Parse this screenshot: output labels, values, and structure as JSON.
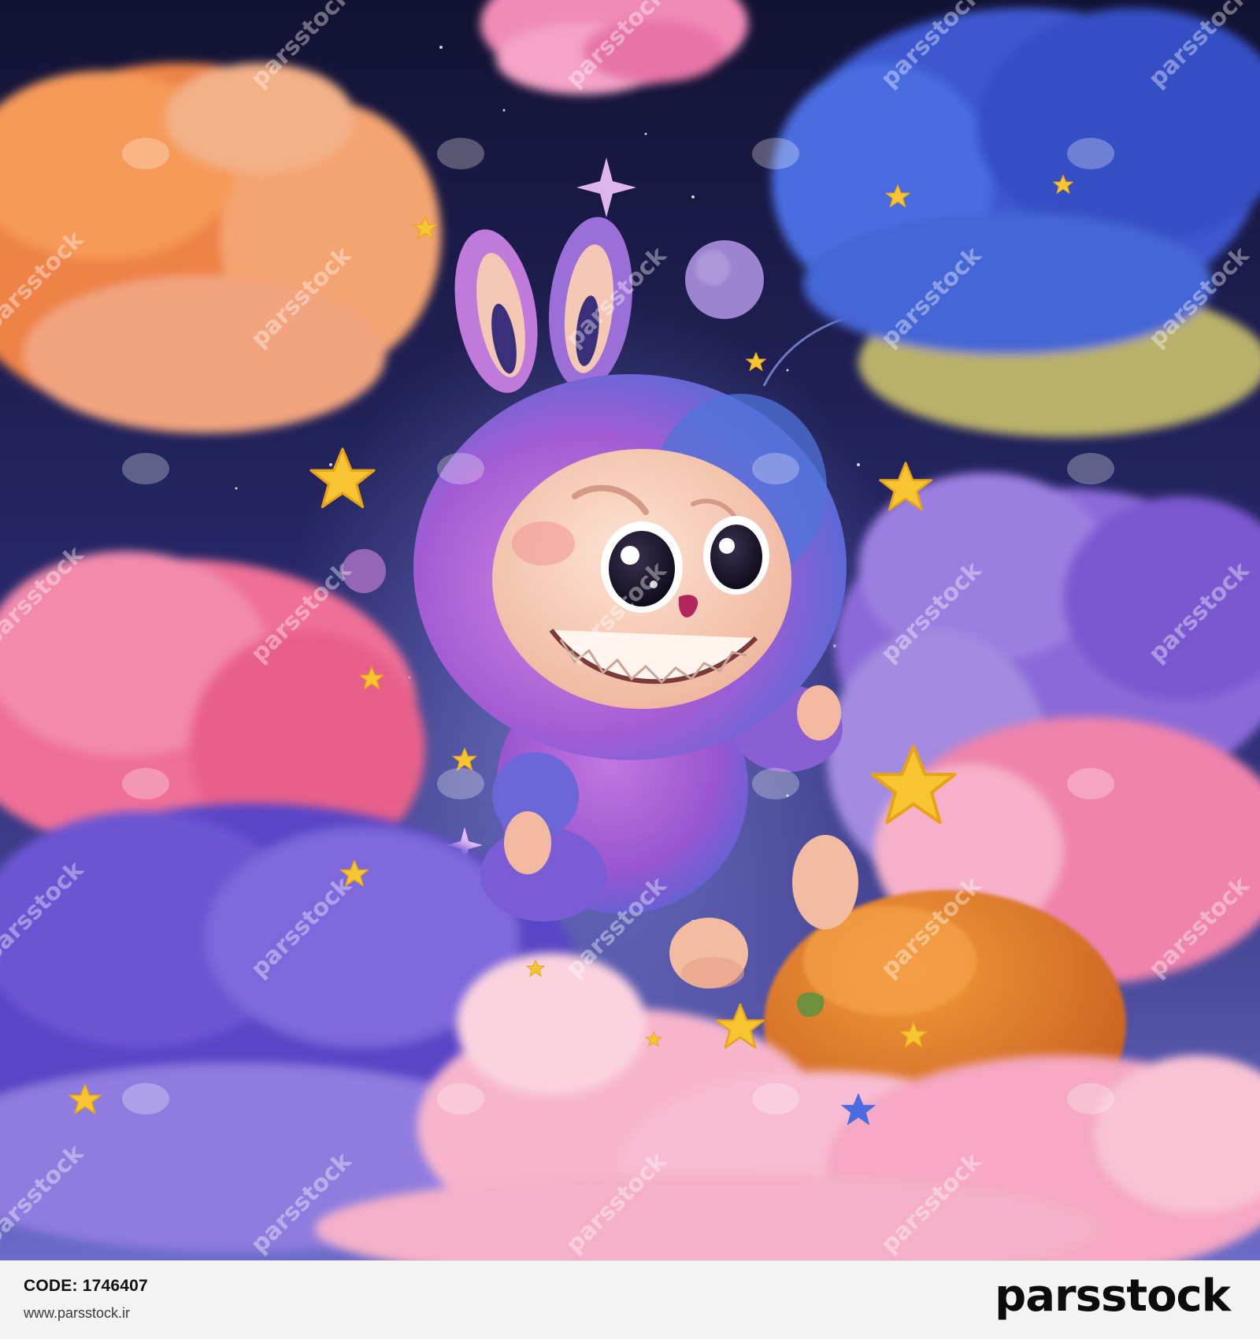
{
  "image": {
    "subject": "plush-bunny-monster-toy",
    "palette": {
      "sky_top": "#141437",
      "sky_bottom": "#4a4aa8",
      "cloud_orange": "#f08a4b",
      "cloud_blue": "#3b5bd1",
      "cloud_pink": "#f07aa6",
      "cloud_purple": "#7c5cd6",
      "star_yellow": "#f6c531",
      "fur_purple": "#a95fd2",
      "fur_blue": "#4f72d8",
      "face": "#f6cdb7"
    }
  },
  "watermark": {
    "text": "parsstock"
  },
  "footer": {
    "code_label": "CODE: 1746407",
    "website": "www.parsstock.ir",
    "brand": "parsstock"
  }
}
